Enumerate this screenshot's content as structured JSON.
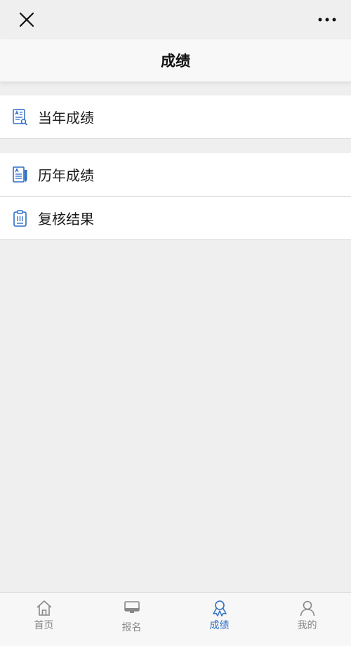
{
  "header": {
    "close_icon": "close-icon",
    "more_icon": "more-icon",
    "title": "成绩"
  },
  "colors": {
    "accent": "#2f6fc6",
    "tab_inactive": "#888888",
    "background": "#efefef"
  },
  "menu": {
    "groups": [
      {
        "items": [
          {
            "label": "当年成绩",
            "icon": "report-search-icon"
          }
        ]
      },
      {
        "items": [
          {
            "label": "历年成绩",
            "icon": "history-report-icon"
          },
          {
            "label": "复核结果",
            "icon": "clipboard-icon"
          }
        ]
      }
    ]
  },
  "tabbar": {
    "items": [
      {
        "label": "首页",
        "icon": "home-icon",
        "active": false
      },
      {
        "label": "报名",
        "icon": "monitor-icon",
        "active": false
      },
      {
        "label": "成绩",
        "icon": "award-ribbon-icon",
        "active": true
      },
      {
        "label": "我的",
        "icon": "user-icon",
        "active": false
      }
    ]
  }
}
